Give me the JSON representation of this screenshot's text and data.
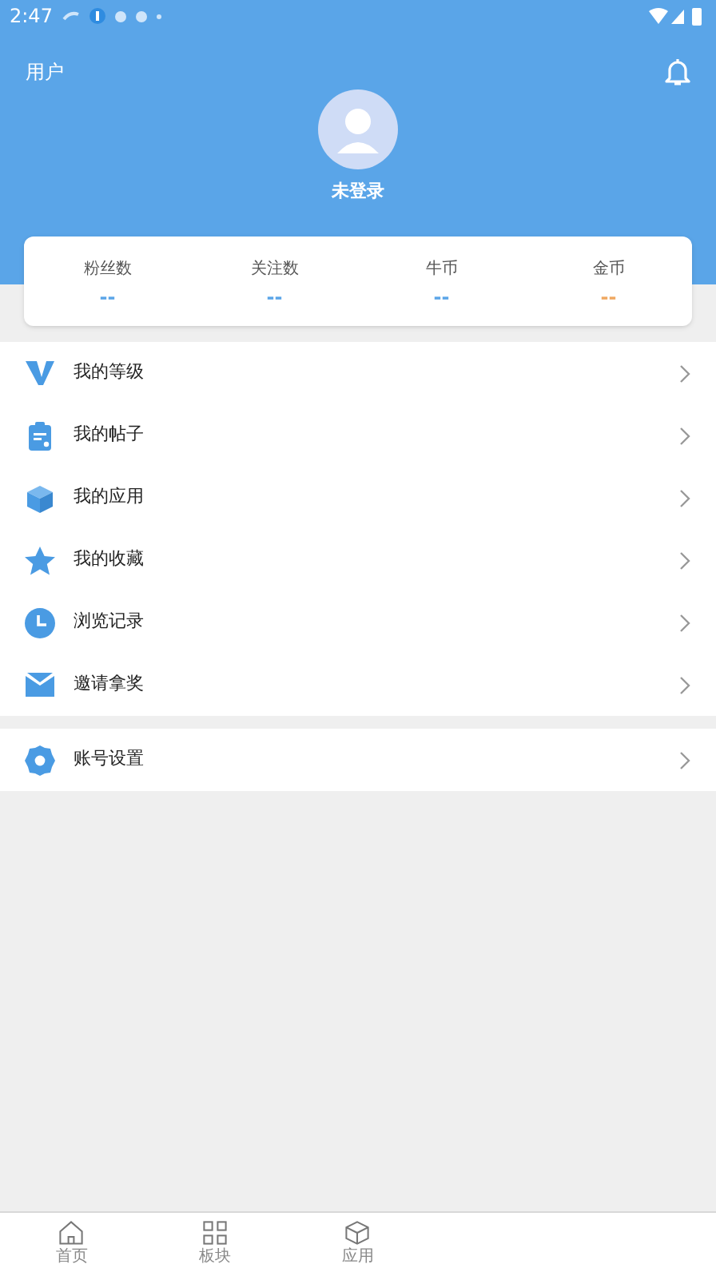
{
  "status_bar": {
    "time": "2:47"
  },
  "header": {
    "title": "用户",
    "username": "未登录"
  },
  "stats": [
    {
      "label": "粉丝数",
      "value": "--",
      "color": "#5aa5e8"
    },
    {
      "label": "关注数",
      "value": "--",
      "color": "#5aa5e8"
    },
    {
      "label": "牛币",
      "value": "--",
      "color": "#5aa5e8"
    },
    {
      "label": "金币",
      "value": "--",
      "color": "#f0a860"
    }
  ],
  "menu_groups": [
    [
      {
        "kind": "level",
        "label": "我的等级"
      },
      {
        "kind": "posts",
        "label": "我的帖子"
      },
      {
        "kind": "apps",
        "label": "我的应用"
      },
      {
        "kind": "favorites",
        "label": "我的收藏"
      },
      {
        "kind": "history",
        "label": "浏览记录"
      },
      {
        "kind": "invite",
        "label": "邀请拿奖"
      }
    ],
    [
      {
        "kind": "settings",
        "label": "账号设置"
      }
    ]
  ],
  "bottom_nav": [
    {
      "kind": "home",
      "label": "首页",
      "selected": false
    },
    {
      "kind": "boards",
      "label": "板块",
      "selected": false
    },
    {
      "kind": "apps",
      "label": "应用",
      "selected": false
    }
  ]
}
